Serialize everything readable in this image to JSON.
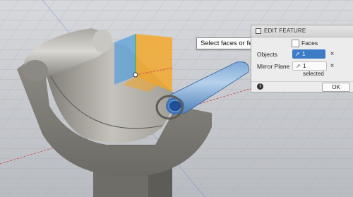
{
  "tooltip": {
    "text": "Select faces or features to mirror"
  },
  "panel": {
    "title": "EDIT FEATURE",
    "faces_label": "Faces",
    "objects_label": "Objects",
    "objects_value": "1 selected",
    "mirror_plane_label": "Mirror Plane",
    "mirror_plane_value": "1 selected",
    "clear_symbol": "×",
    "info_symbol": "i",
    "ok_label": "OK"
  },
  "colors": {
    "active_selection": "#3d7bc6",
    "highlight_face": "#6b9fd6",
    "plane_orange": "#f5a623",
    "plane_blue": "#5aa0dc"
  }
}
